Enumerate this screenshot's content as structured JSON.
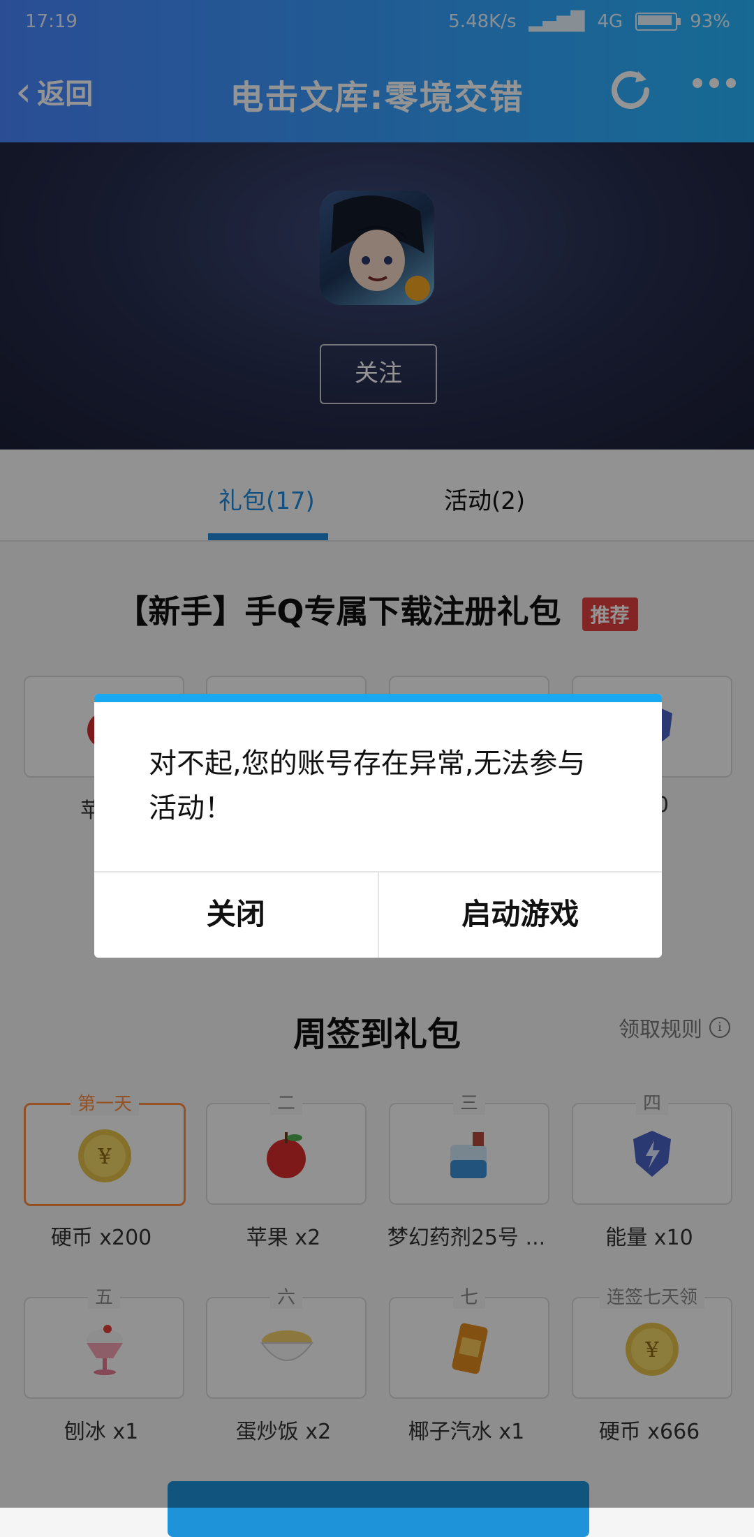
{
  "status": {
    "time": "17:19",
    "network_speed": "5.48K/s",
    "network": "4G",
    "battery": "93%"
  },
  "nav": {
    "back_label": "返回",
    "title": "电击文库:零境交错"
  },
  "hero": {
    "follow_label": "关注"
  },
  "tabs": [
    {
      "label": "礼包(17)",
      "active": true
    },
    {
      "label": "活动(2)",
      "active": false
    }
  ],
  "package": {
    "title": "【新手】手Q专属下载注册礼包",
    "badge": "推荐"
  },
  "package_items": [
    {
      "caption": "苹果",
      "icon": "apple-icon"
    },
    {
      "caption": "",
      "icon": ""
    },
    {
      "caption": "",
      "icon": ""
    },
    {
      "caption": "x10",
      "icon": "energy-shield-icon"
    }
  ],
  "weekly": {
    "title": "周签到礼包",
    "rules_label": "领取规则",
    "items": [
      {
        "day": "第一天",
        "caption": "硬币 x200",
        "icon": "coin-icon"
      },
      {
        "day": "二",
        "caption": "苹果 x2",
        "icon": "apple-icon"
      },
      {
        "day": "三",
        "caption": "梦幻药剂25号 ...",
        "icon": "potion-icon"
      },
      {
        "day": "四",
        "caption": "能量 x10",
        "icon": "energy-shield-icon"
      },
      {
        "day": "五",
        "caption": "刨冰 x1",
        "icon": "shaved-ice-icon"
      },
      {
        "day": "六",
        "caption": "蛋炒饭 x2",
        "icon": "fried-rice-icon"
      },
      {
        "day": "七",
        "caption": "椰子汽水 x1",
        "icon": "coconut-soda-icon"
      },
      {
        "day": "连签七天领",
        "caption": "硬币 x666",
        "icon": "coin-icon"
      }
    ]
  },
  "dialog": {
    "message": "对不起,您的账号存在异常,无法参与活动！",
    "close_label": "关闭",
    "launch_label": "启动游戏"
  },
  "colors": {
    "accent": "#1f8bdb",
    "badge": "#e1403e",
    "highlight": "#ff8c42"
  }
}
